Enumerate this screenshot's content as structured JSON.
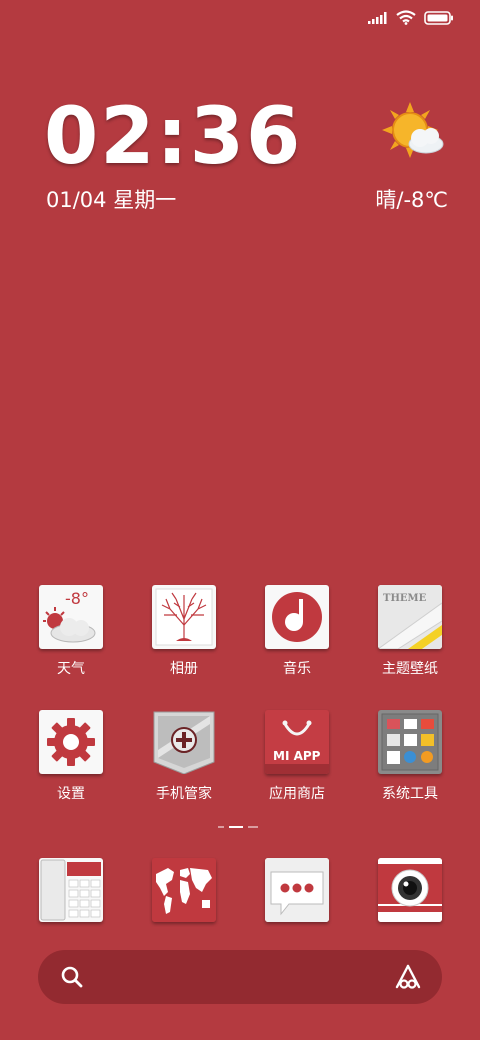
{
  "status_bar": {
    "icons": [
      "signal-icon",
      "wifi-icon",
      "battery-icon"
    ]
  },
  "clock": {
    "time": "02:36",
    "date": "01/04 星期一"
  },
  "weather": {
    "text": "晴/-8℃",
    "icon": "sunny-cloud-icon"
  },
  "apps_row1": [
    {
      "label": "天气",
      "icon": "weather-app-icon",
      "temp": "-8°"
    },
    {
      "label": "相册",
      "icon": "gallery-tree-icon"
    },
    {
      "label": "音乐",
      "icon": "music-note-icon"
    },
    {
      "label": "主题壁纸",
      "icon": "theme-icon",
      "tag": "THEME"
    }
  ],
  "apps_row2": [
    {
      "label": "设置",
      "icon": "gear-icon"
    },
    {
      "label": "手机管家",
      "icon": "security-shield-icon"
    },
    {
      "label": "应用商店",
      "icon": "app-store-bag-icon",
      "brand": "MI APP"
    },
    {
      "label": "系统工具",
      "icon": "system-tools-folder-icon"
    }
  ],
  "dock": [
    {
      "name": "phone",
      "icon": "phone-icon"
    },
    {
      "name": "browser",
      "icon": "world-map-icon"
    },
    {
      "name": "messages",
      "icon": "message-icon"
    },
    {
      "name": "camera",
      "icon": "camera-icon"
    }
  ],
  "page_indicator": {
    "pages": 3,
    "current": 2
  },
  "search_bar": {
    "search_icon": "search-icon",
    "assistant_icon": "assistant-icon"
  },
  "colors": {
    "background": "#b43a40",
    "accent": "#c0393f",
    "tile": "#f8f8f8"
  }
}
